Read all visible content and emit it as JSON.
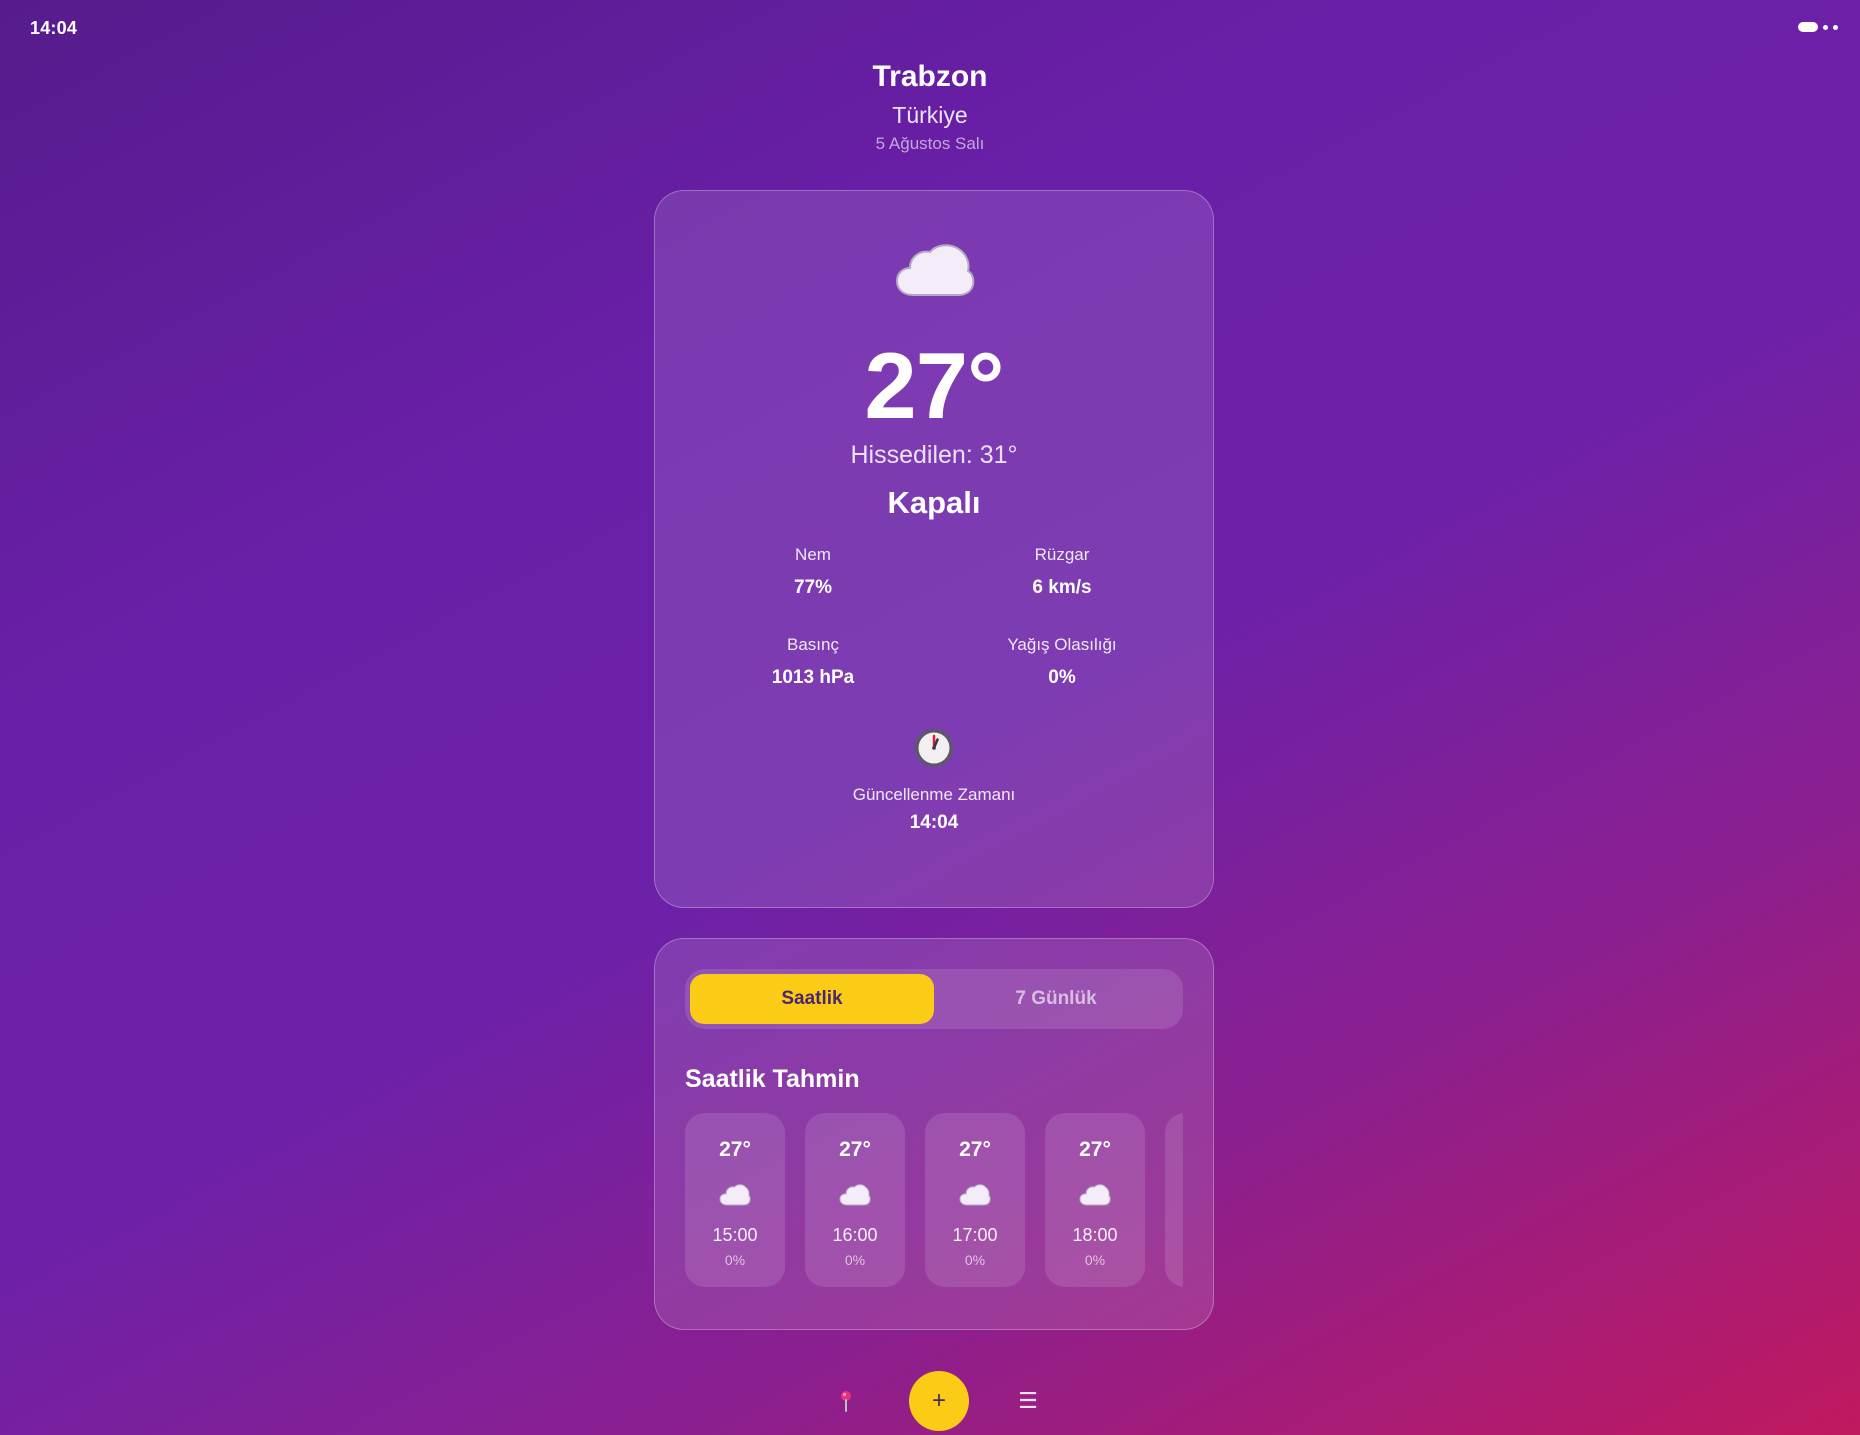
{
  "status_bar": {
    "time": "14:04",
    "indicator_icon": "more-dots-icon"
  },
  "location": {
    "city": "Trabzon",
    "country": "Türkiye",
    "date": "5 Ağustos Salı"
  },
  "current": {
    "icon": "cloud-icon",
    "temperature": "27°",
    "feels_like": "Hissedilen: 31°",
    "condition": "Kapalı",
    "metrics": {
      "humidity": {
        "label": "Nem",
        "value": "77%"
      },
      "wind": {
        "label": "Rüzgar",
        "value": "6 km/s"
      },
      "pressure": {
        "label": "Basınç",
        "value": "1013 hPa"
      },
      "rain_chance": {
        "label": "Yağış Olasılığı",
        "value": "0%"
      }
    },
    "updated": {
      "icon": "clock-icon",
      "label": "Güncellenme Zamanı",
      "time": "14:04"
    }
  },
  "forecast": {
    "tabs": [
      {
        "label": "Saatlik",
        "active": true
      },
      {
        "label": "7 Günlük",
        "active": false
      }
    ],
    "title": "Saatlik Tahmin",
    "hourly": [
      {
        "temp": "27°",
        "icon": "cloud-icon",
        "time": "15:00",
        "precip": "0%"
      },
      {
        "temp": "27°",
        "icon": "cloud-icon",
        "time": "16:00",
        "precip": "0%"
      },
      {
        "temp": "27°",
        "icon": "cloud-icon",
        "time": "17:00",
        "precip": "0%"
      },
      {
        "temp": "27°",
        "icon": "cloud-icon",
        "time": "18:00",
        "precip": "0%"
      }
    ]
  },
  "nav": {
    "location_icon": "map-pin-icon",
    "add_label": "+",
    "menu_label": "☰",
    "menu_icon": "menu-icon"
  },
  "colors": {
    "accent": "#facc15",
    "accent_text": "#4a2870",
    "background_start": "#561c8c",
    "background_end": "#c0195f"
  }
}
